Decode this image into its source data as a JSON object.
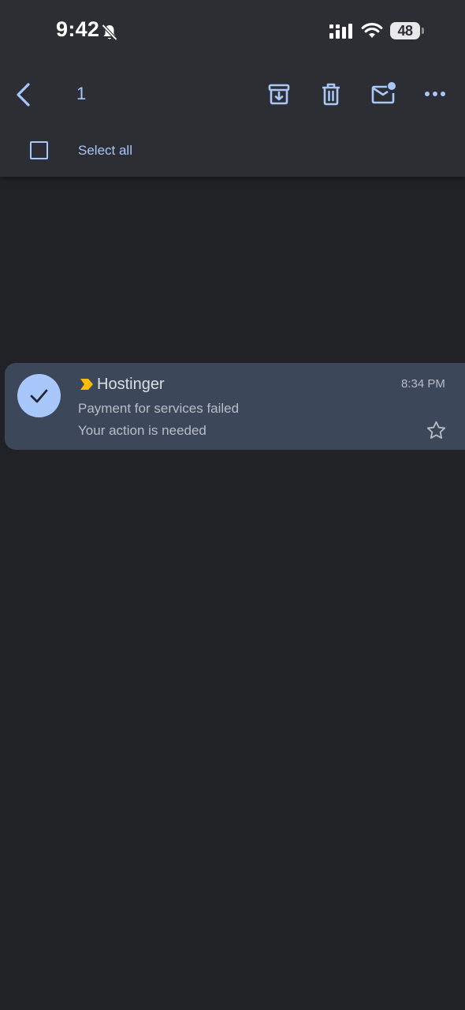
{
  "status_bar": {
    "time": "9:42",
    "battery": "48",
    "icons": [
      "bell-off-icon",
      "signal-icon",
      "wifi-icon",
      "battery-icon"
    ]
  },
  "action_bar": {
    "selected_count": "1",
    "icons": [
      "back-arrow-icon",
      "archive-icon",
      "trash-icon",
      "mark-unread-icon",
      "more-icon"
    ],
    "select_all_label": "Select all"
  },
  "email": {
    "sender": "Hostinger",
    "time": "8:34 PM",
    "subject": "Payment for services failed",
    "snippet": "Your action is needed",
    "selected": true,
    "starred": false,
    "important_marker_color": "#fbbc04"
  },
  "colors": {
    "accent": "#a8c7fa",
    "background": "#212226",
    "toolbar": "#2d2e33",
    "selected_row": "#3c4759"
  }
}
